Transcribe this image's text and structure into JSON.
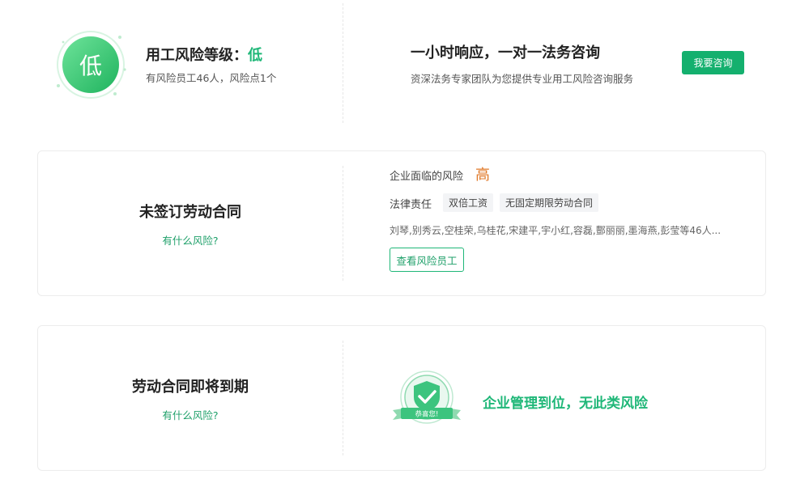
{
  "summary": {
    "badge_text": "低",
    "title_prefix": "用工风险等级：",
    "title_level": "低",
    "subtitle": "有风险员工46人，风险点1个",
    "consult_title": "一小时响应，一对一法务咨询",
    "consult_subtitle": "资深法务专家团队为您提供专业用工风险咨询服务",
    "consult_button": "我要咨询"
  },
  "cards": [
    {
      "title": "未签订劳动合同",
      "link": "有什么风险?",
      "risk_label": "企业面临的风险",
      "risk_value": "高",
      "law_label": "法律责任",
      "law_tags": [
        "双倍工资",
        "无固定期限劳动合同"
      ],
      "employees": "刘琴,别秀云,空桂荣,乌桂花,宋建平,宇小红,容磊,酆丽丽,墨海燕,彭莹等46人...",
      "button": "查看风险员工"
    },
    {
      "title": "劳动合同即将到期",
      "link": "有什么风险?",
      "badge_ribbon": "恭喜您!",
      "message": "企业管理到位，无此类风险"
    }
  ],
  "colors": {
    "green": "#14b06e",
    "risk_high": "#e07a2a"
  }
}
